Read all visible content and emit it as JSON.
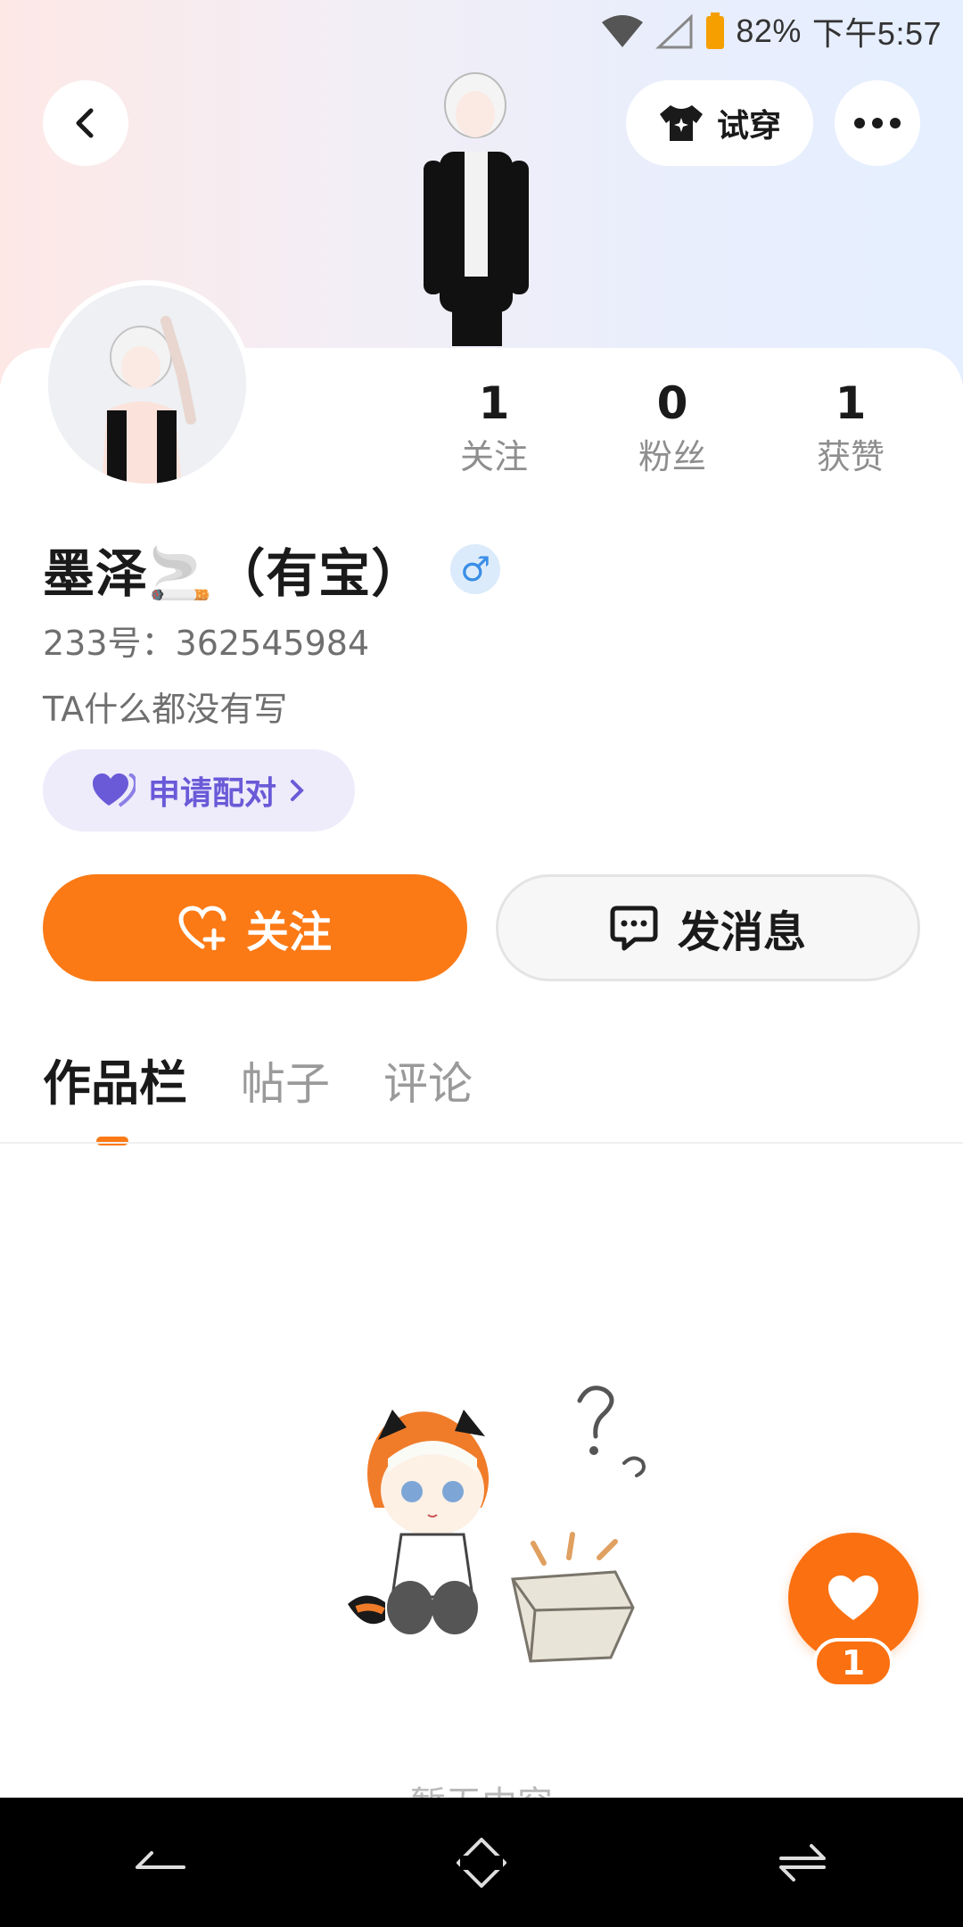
{
  "status_bar": {
    "battery": "82%",
    "time": "下午5:57"
  },
  "header": {
    "tryon_label": "试穿"
  },
  "stats": [
    {
      "value": "1",
      "label": "关注"
    },
    {
      "value": "0",
      "label": "粉丝"
    },
    {
      "value": "1",
      "label": "获赞"
    }
  ],
  "profile": {
    "name": "墨泽🚬（有宝）",
    "gender_symbol": "♂",
    "uid": "233号：362545984",
    "bio": "TA什么都没有写"
  },
  "pair_button": {
    "label": "申请配对"
  },
  "actions": {
    "follow_label": "关注",
    "message_label": "发消息"
  },
  "tabs": [
    {
      "label": "作品栏",
      "active": true
    },
    {
      "label": "帖子",
      "active": false
    },
    {
      "label": "评论",
      "active": false
    }
  ],
  "empty_state": {
    "text": "暂无内容"
  },
  "like_fab": {
    "count": "1"
  },
  "colors": {
    "accent": "#fb7a16",
    "pair": "#6a5ad8",
    "gender": "#3a8ee6"
  },
  "icons": [
    "back-icon",
    "shirt-icon",
    "more-icon",
    "heart-icon",
    "follow-heart-icon",
    "chat-icon",
    "nav-back-icon",
    "nav-home-icon",
    "nav-recent-icon"
  ]
}
